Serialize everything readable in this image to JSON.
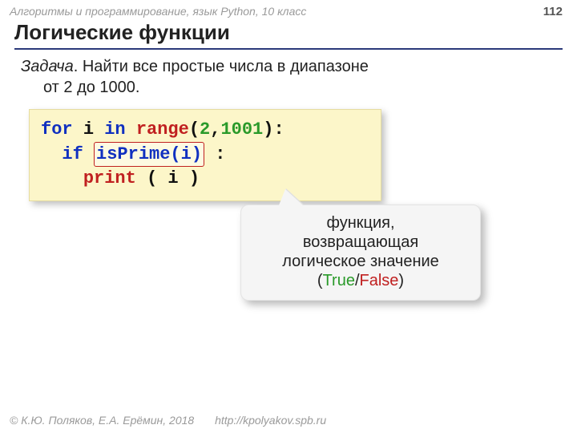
{
  "header": {
    "course": "Алгоритмы и программирование, язык Python, 10 класс",
    "page": "112"
  },
  "title": "Логические функции",
  "task": {
    "label": "Задача",
    "line1": ". Найти все простые числа в диапазоне",
    "line2": "от 2 до 1000."
  },
  "code": {
    "l1": {
      "for": "for",
      "i": "i",
      "in": "in",
      "range": "range",
      "open": "(",
      "a": "2",
      "comma": ",",
      "b": "1001",
      "close": "):"
    },
    "l2": {
      "indent": "  ",
      "if": "if",
      "sp": " ",
      "fn": "isPrime(i)",
      "close": " :"
    },
    "l3": {
      "indent": "    ",
      "print": "print",
      "args": " ( i )"
    }
  },
  "callout": {
    "line1": "функция,",
    "line2": "возвращающая",
    "line3": "логическое значение",
    "true": "True",
    "slash": "/",
    "false": "False"
  },
  "footer": {
    "copyright": "© К.Ю. Поляков, Е.А. Ерёмин, 2018",
    "url": "http://kpolyakov.spb.ru"
  }
}
